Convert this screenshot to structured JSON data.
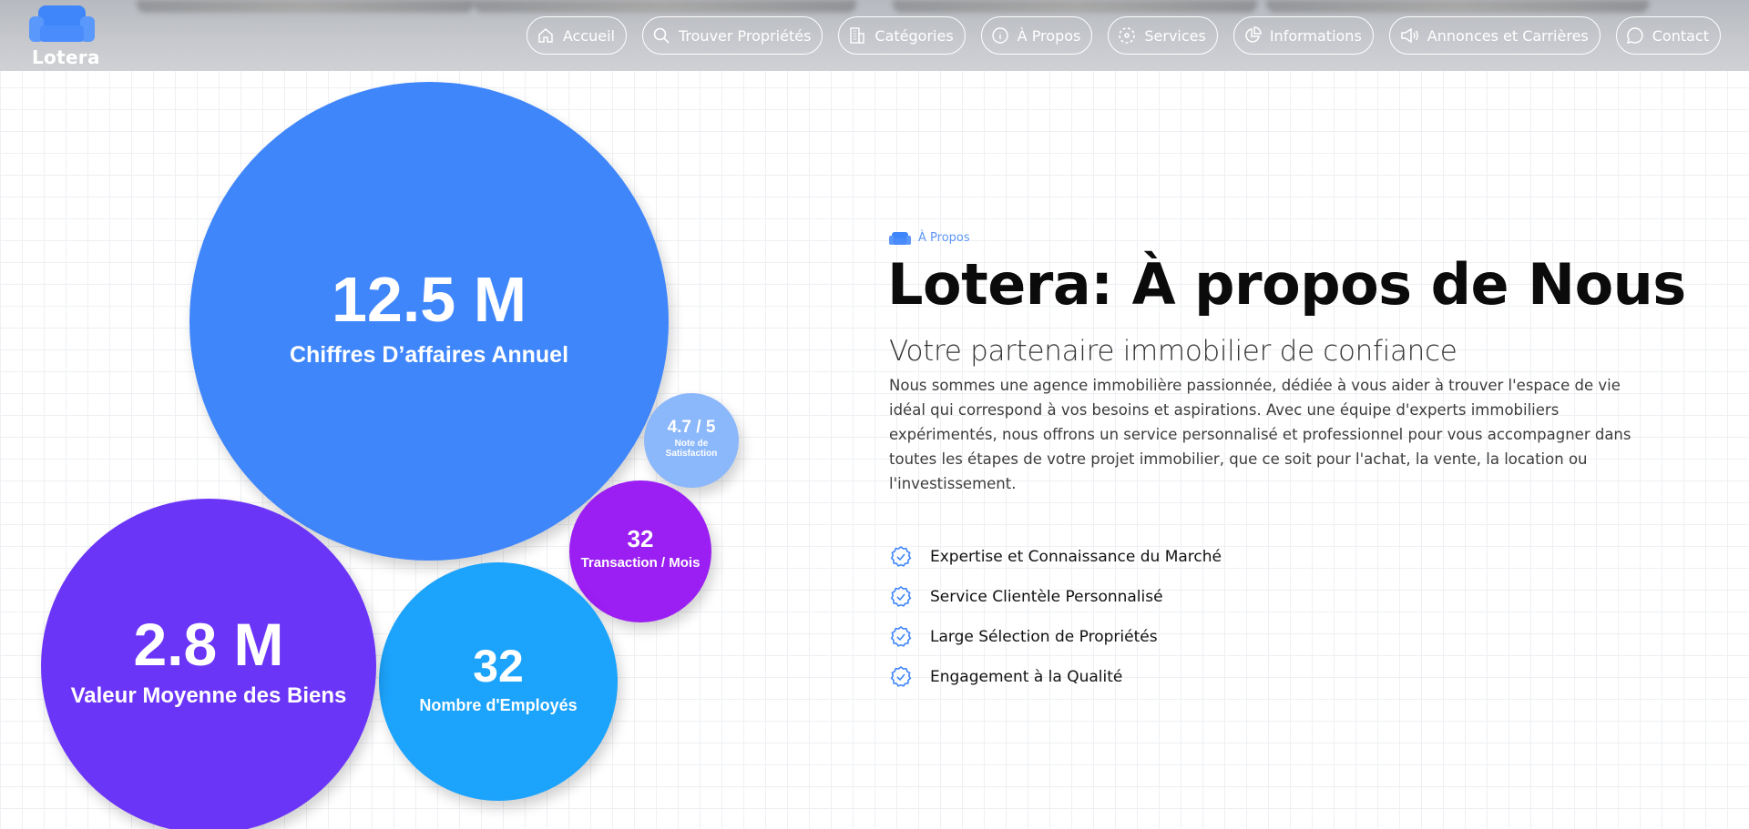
{
  "brand": {
    "name": "Lotera",
    "accent": "#3f86fb"
  },
  "nav": {
    "items": [
      {
        "label": "Accueil",
        "icon": "home-icon"
      },
      {
        "label": "Trouver Propriétés",
        "icon": "search-icon"
      },
      {
        "label": "Catégories",
        "icon": "building-icon"
      },
      {
        "label": "À Propos",
        "icon": "info-icon"
      },
      {
        "label": "Services",
        "icon": "services-icon"
      },
      {
        "label": "Informations",
        "icon": "pie-chart-icon"
      },
      {
        "label": "Annonces et Carrières",
        "icon": "megaphone-icon"
      },
      {
        "label": "Contact",
        "icon": "chat-icon"
      }
    ]
  },
  "stats": {
    "revenue": {
      "value": "12.5 M",
      "label": "Chiffres D’affaires Annuel",
      "color": "#3f86fb"
    },
    "avg_value": {
      "value": "2.8 M",
      "label": "Valeur Moyenne des Biens",
      "color": "#6b35f7"
    },
    "employees": {
      "value": "32",
      "label": "Nombre d'Employés",
      "color": "#1ca3fb"
    },
    "transactions": {
      "value": "32",
      "label": "Transaction / Mois",
      "color": "#9b1ef2"
    },
    "satisfaction": {
      "value": "4.7 / 5",
      "label": "Note de Satisfaction",
      "color": "#8bb7fb"
    }
  },
  "about": {
    "eyebrow": "À Propos",
    "title": "Lotera: À propos de Nous",
    "subtitle": "Votre partenaire immobilier de confiance",
    "description": "Nous sommes une agence immobilière passionnée, dédiée à vous aider à trouver l'espace de vie idéal qui correspond à vos besoins et aspirations. Avec une équipe d'experts immobiliers expérimentés, nous offrons un service personnalisé et professionnel pour vous accompagner dans toutes les étapes de votre projet immobilier, que ce soit pour l'achat, la vente, la location ou l'investissement.",
    "features": [
      "Expertise et Connaissance du Marché",
      "Service Clientèle Personnalisé",
      "Large Sélection de Propriétés",
      "Engagement à la Qualité"
    ]
  }
}
